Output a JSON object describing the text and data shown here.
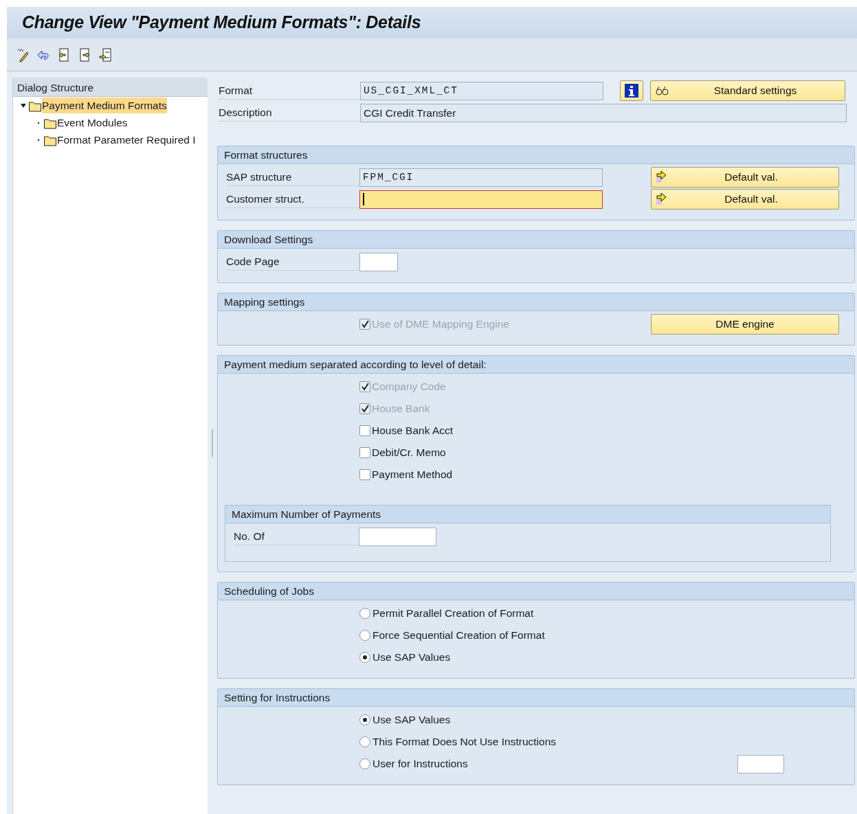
{
  "window": {
    "title": "Change View \"Payment Medium Formats\": Details"
  },
  "toolbar": [
    {
      "kind": "display-change"
    },
    {
      "kind": "undo"
    },
    {
      "kind": "previous"
    },
    {
      "kind": "next"
    },
    {
      "kind": "variable-list"
    }
  ],
  "dialog_structure": {
    "title": "Dialog Structure",
    "items": [
      {
        "label": "Payment Medium Formats",
        "selected": true,
        "expanded": true,
        "children": [
          {
            "label": "Event Modules",
            "selected": false
          },
          {
            "label": "Format Parameter Required I",
            "selected": false
          }
        ]
      }
    ]
  },
  "header": {
    "rows": [
      {
        "label": "Format",
        "value": "US_CGI_XML_CT",
        "kind": "text-field",
        "editable": false,
        "focused": false,
        "info_button": true,
        "button": {
          "label": "Standard settings",
          "kind": "with-glasses"
        }
      },
      {
        "label": "Description",
        "value": "CGI Credit Transfer",
        "kind": "wide-field",
        "editable": false,
        "focused": false
      }
    ]
  },
  "sections": [
    {
      "title": "Format structures",
      "rows": [
        {
          "kind": "text-field",
          "label": "SAP structure",
          "value": "FPM_CGI",
          "editable": false,
          "focused": false,
          "button": {
            "label": "Default val.",
            "kind": "with-arrow"
          }
        },
        {
          "kind": "text-field",
          "label": "Customer struct.",
          "editable": true,
          "focused": true,
          "button": {
            "label": "Default val.",
            "kind": "with-arrow"
          }
        }
      ]
    },
    {
      "title": "Download Settings",
      "rows": [
        {
          "kind": "small-field",
          "label": "Code Page",
          "editable": true,
          "focused": false
        }
      ]
    },
    {
      "title": "Mapping settings",
      "rows": [
        {
          "kind": "checkbox",
          "label": "Use of DME Mapping Engine",
          "checked": true,
          "disabled": true,
          "button": {
            "label": "DME engine",
            "kind": "plain"
          }
        }
      ]
    },
    {
      "title": "Payment medium separated according to level of detail:",
      "rows": [
        {
          "kind": "checkbox",
          "label": "Company Code",
          "checked": true,
          "disabled": true
        },
        {
          "kind": "checkbox",
          "label": "House Bank",
          "checked": true,
          "disabled": true
        },
        {
          "kind": "checkbox",
          "label": "House Bank Acct",
          "checked": false,
          "disabled": false
        },
        {
          "kind": "checkbox",
          "label": "Debit/Cr. Memo",
          "checked": false,
          "disabled": false
        },
        {
          "kind": "checkbox",
          "label": "Payment Method",
          "checked": false,
          "disabled": false
        },
        {
          "kind": "group",
          "title": "Maximum Number of Payments",
          "rows": [
            {
              "kind": "medium-field",
              "label": "No. Of",
              "editable": true,
              "focused": false
            }
          ]
        }
      ]
    },
    {
      "title": "Scheduling of Jobs",
      "rows": [
        {
          "kind": "radio",
          "label": "Permit Parallel Creation of Format",
          "selected": false
        },
        {
          "kind": "radio",
          "label": "Force Sequential Creation of Format",
          "selected": false
        },
        {
          "kind": "radio",
          "label": "Use SAP Values",
          "selected": true
        }
      ]
    },
    {
      "title": "Setting for Instructions",
      "rows": [
        {
          "kind": "radio",
          "label": "Use SAP Values",
          "selected": true
        },
        {
          "kind": "radio",
          "label": "This Format Does Not Use Instructions",
          "selected": false
        },
        {
          "kind": "radio-with-field",
          "label": "User for Instructions",
          "selected": false
        }
      ]
    }
  ]
}
